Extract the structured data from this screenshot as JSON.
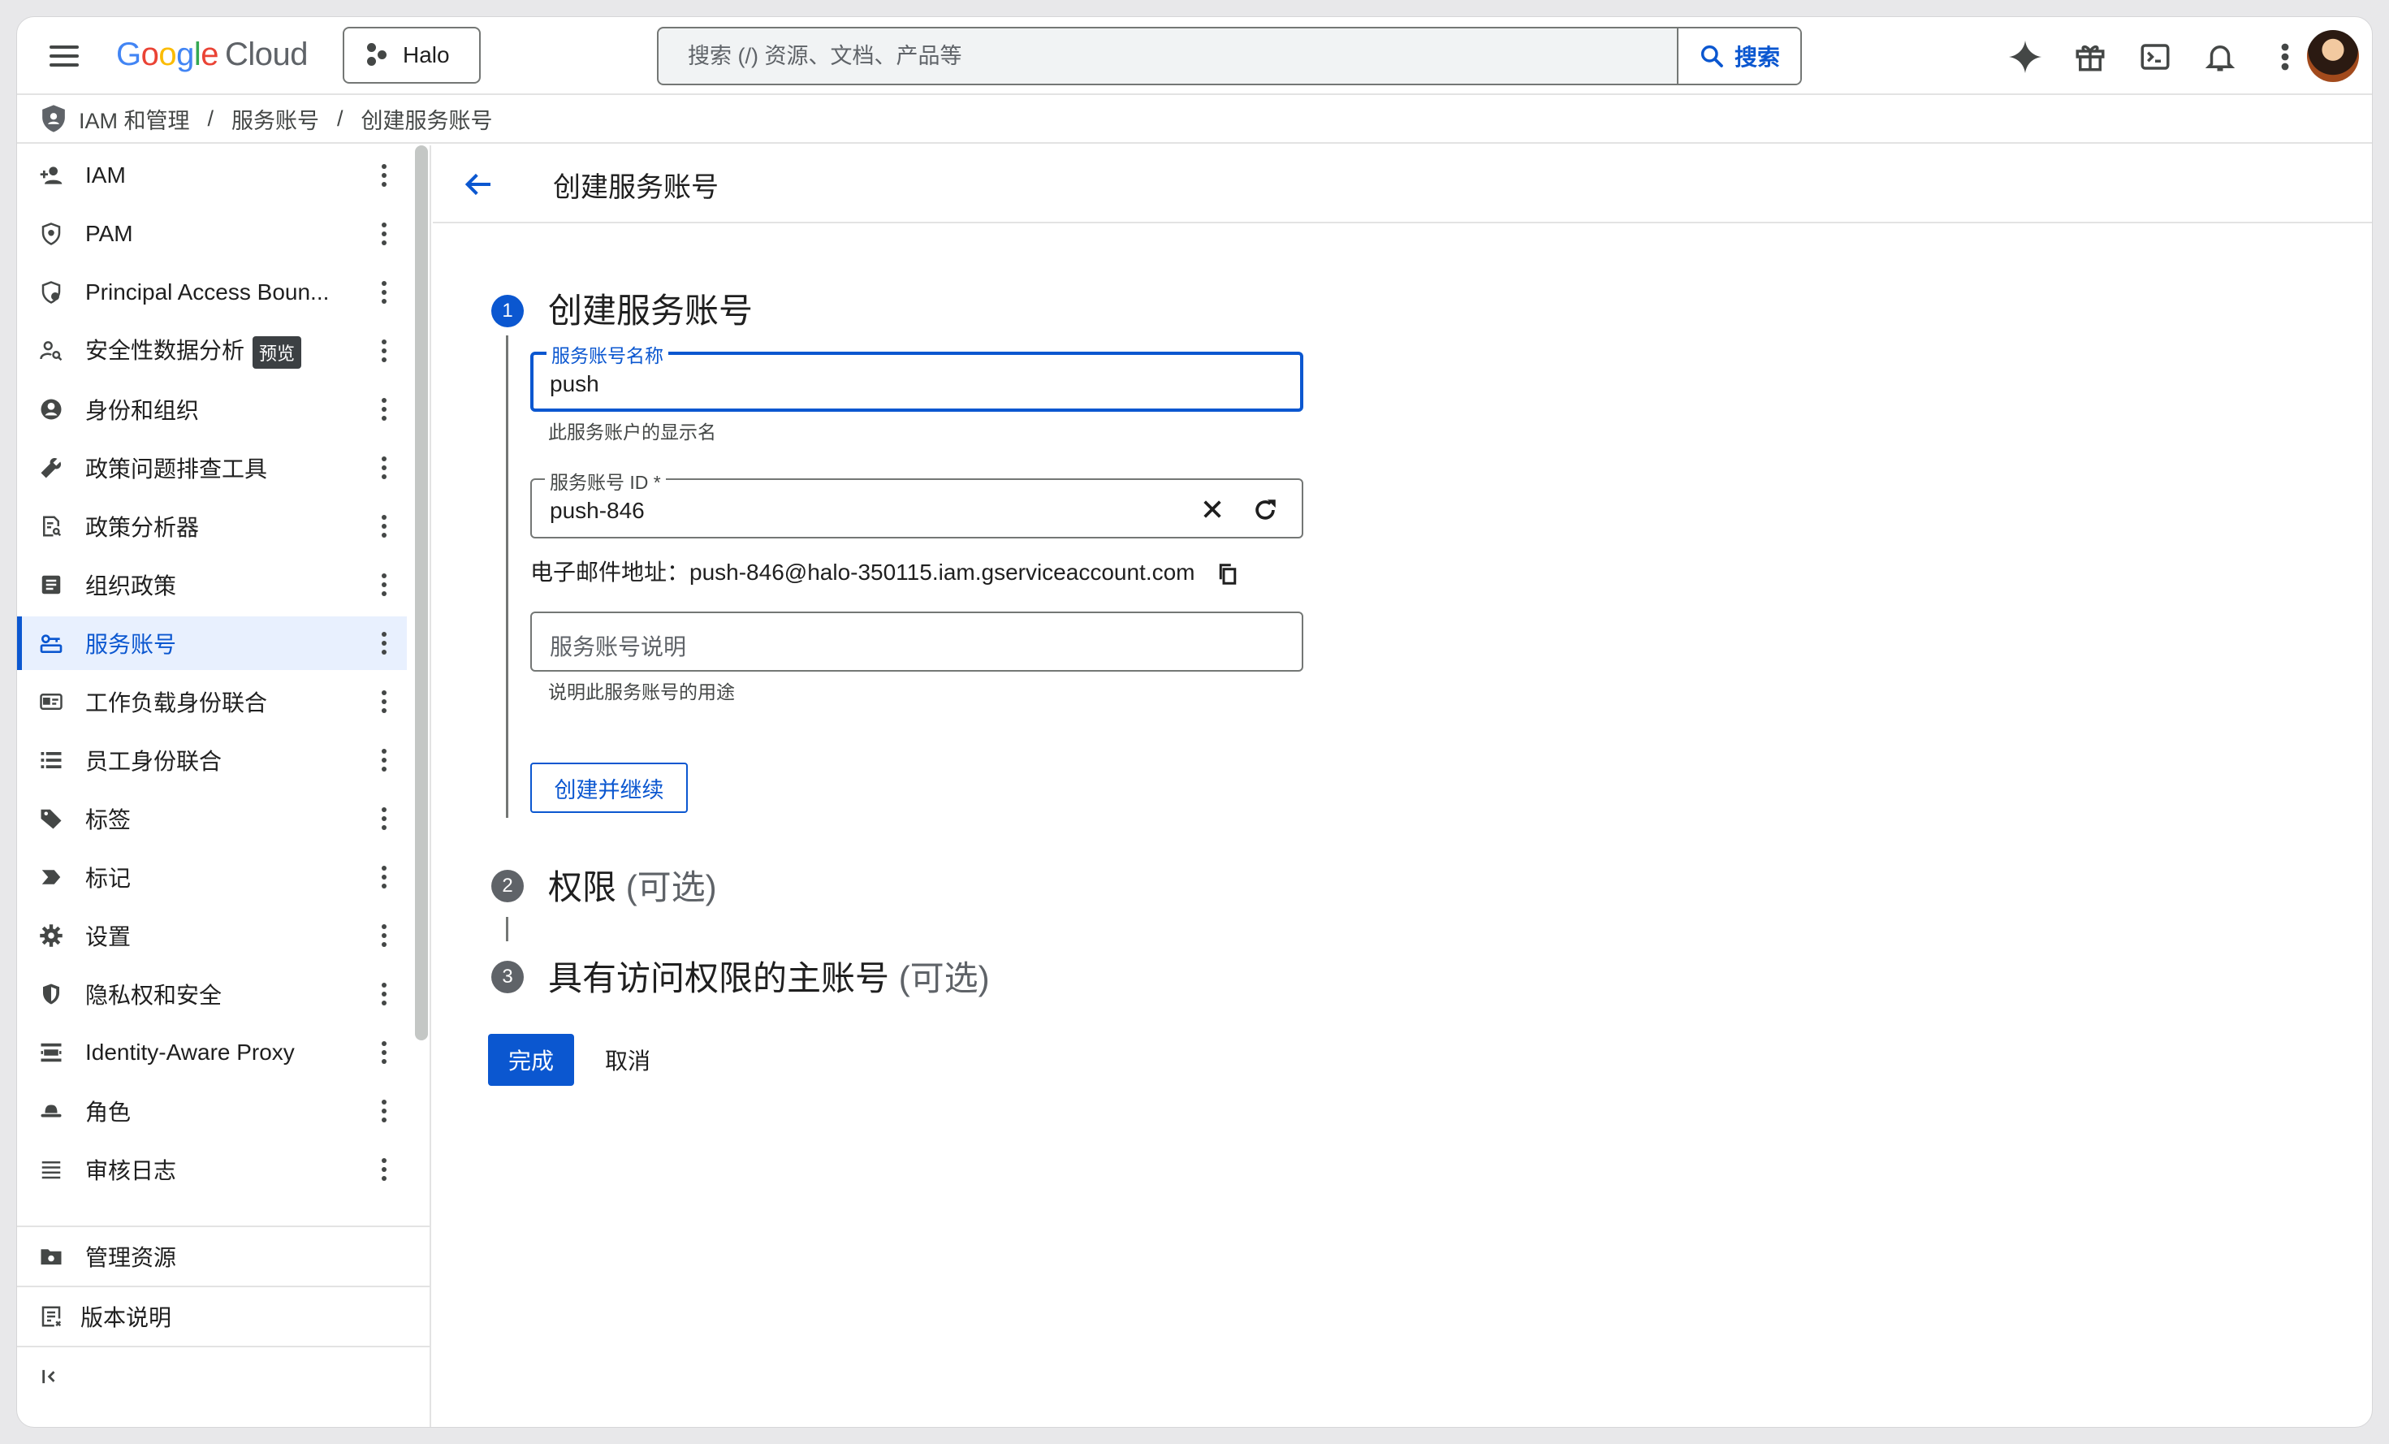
{
  "topbar": {
    "logo_google": "Google",
    "logo_cloud": "Cloud",
    "project": "Halo",
    "search_placeholder": "搜索 (/) 资源、文档、产品等",
    "search_button": "搜索",
    "icons": [
      "gemini-icon",
      "gift-icon",
      "terminal-icon",
      "bell-icon",
      "more-vert-icon"
    ]
  },
  "breadcrumb": {
    "items": [
      "IAM 和管理",
      "服务账号",
      "创建服务账号"
    ],
    "separator": "/"
  },
  "sidebar": {
    "items": [
      {
        "label": "IAM",
        "icon": "person-add-icon"
      },
      {
        "label": "PAM",
        "icon": "shield-lock-icon"
      },
      {
        "label": "Principal Access Boun...",
        "icon": "shield-check-icon"
      },
      {
        "label": "安全性数据分析",
        "icon": "person-search-icon",
        "badge": "预览"
      },
      {
        "label": "身份和组织",
        "icon": "account-circle-icon"
      },
      {
        "label": "政策问题排查工具",
        "icon": "wrench-icon"
      },
      {
        "label": "政策分析器",
        "icon": "doc-search-icon"
      },
      {
        "label": "组织政策",
        "icon": "list-box-icon"
      },
      {
        "label": "服务账号",
        "icon": "service-account-icon",
        "active": true
      },
      {
        "label": "工作负载身份联合",
        "icon": "id-card-icon"
      },
      {
        "label": "员工身份联合",
        "icon": "list-icon"
      },
      {
        "label": "标签",
        "icon": "tag-icon"
      },
      {
        "label": "标记",
        "icon": "label-icon"
      },
      {
        "label": "设置",
        "icon": "gear-icon"
      },
      {
        "label": "隐私权和安全",
        "icon": "shield-icon"
      },
      {
        "label": "Identity-Aware Proxy",
        "icon": "proxy-icon"
      },
      {
        "label": "角色",
        "icon": "hat-icon"
      },
      {
        "label": "审核日志",
        "icon": "lines-icon"
      }
    ],
    "bottom": [
      {
        "label": "管理资源",
        "icon": "folder-gear-icon"
      },
      {
        "label": "版本说明",
        "icon": "notes-icon"
      }
    ],
    "collapse_icon": "collapse-icon"
  },
  "main": {
    "title": "创建服务账号",
    "steps": [
      {
        "number": "1",
        "title": "创建服务账号",
        "optional": ""
      },
      {
        "number": "2",
        "title": "权限",
        "optional": "(可选)"
      },
      {
        "number": "3",
        "title": "具有访问权限的主账号",
        "optional": "(可选)"
      }
    ],
    "form": {
      "name_label": "服务账号名称",
      "name_value": "push",
      "name_hint": "此服务账户的显示名",
      "id_label": "服务账号 ID *",
      "id_value": "push-846",
      "email_label": "电子邮件地址：",
      "email_value": "push-846@halo-350115.iam.gserviceaccount.com",
      "desc_placeholder": "服务账号说明",
      "desc_hint": "说明此服务账号的用途",
      "create_button": "创建并继续"
    },
    "done_button": "完成",
    "cancel_button": "取消"
  }
}
